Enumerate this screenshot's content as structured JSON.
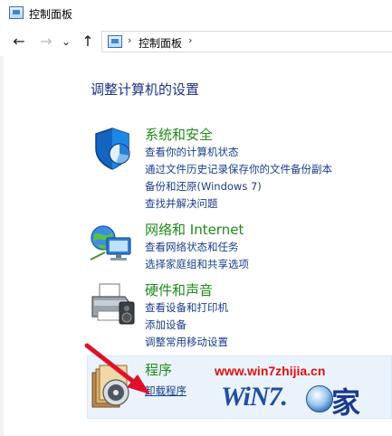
{
  "window": {
    "title": "控制面板"
  },
  "nav": {
    "back": "←",
    "forward": "→",
    "dropdown": "⌄",
    "up": "↑",
    "separator": "›",
    "breadcrumb": "控制面板"
  },
  "main": {
    "heading": "调整计算机的设置",
    "categories": [
      {
        "title": "系统和安全",
        "icon": "shield-icon",
        "links": [
          "查看你的计算机状态",
          "通过文件历史记录保存你的文件备份副本",
          "备份和还原(Windows 7)",
          "查找并解决问题"
        ]
      },
      {
        "title": "网络和 Internet",
        "icon": "network-globe-icon",
        "links": [
          "查看网络状态和任务",
          "选择家庭组和共享选项"
        ]
      },
      {
        "title": "硬件和声音",
        "icon": "printer-icon",
        "links": [
          "查看设备和打印机",
          "添加设备",
          "调整常用移动设置"
        ]
      },
      {
        "title": "程序",
        "icon": "programs-disc-icon",
        "links": [
          "卸载程序"
        ]
      }
    ]
  },
  "watermark": {
    "url": "www.win7zhijia.cn",
    "logo_text": "WiN7.",
    "logo_char": "家"
  },
  "colors": {
    "category_title": "#1f8a1a",
    "link": "#1b3d8c",
    "heading": "#1e3287",
    "highlight_bg": "#eaf3fb",
    "arrow": "#e0102a"
  }
}
